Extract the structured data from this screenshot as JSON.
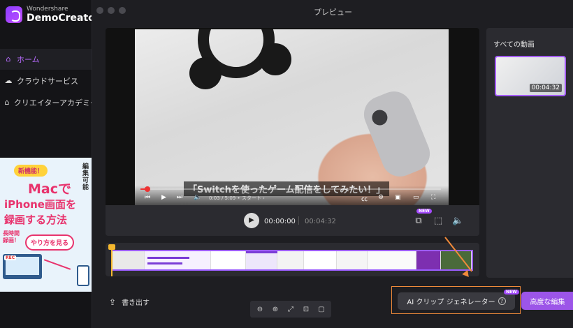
{
  "sidebar": {
    "brand": "Wondershare",
    "product": "DemoCreator",
    "items": [
      {
        "label": "ホーム",
        "icon": "home-icon"
      },
      {
        "label": "クラウドサービス",
        "icon": "cloud-icon"
      },
      {
        "label": "クリエイターアカデミー",
        "icon": "graduation-cap-icon"
      }
    ],
    "promo": {
      "badge": "新機能！",
      "side_text": "編集可能",
      "line1": "Macで",
      "line2": "iPhone画面を",
      "line3": "録画する方法",
      "time_text": "長時間録画！",
      "howto": "やり方を見る",
      "rec": "REC"
    }
  },
  "modal": {
    "title": "プレビュー",
    "video": {
      "subtitle": "「Switchを使ったゲーム配信をしてみたい！」",
      "yt_time": "0:03 / 5:09 • スタート ›"
    },
    "player": {
      "current_time": "00:00:00",
      "total_time": "00:04:32",
      "new_badge": "NEW"
    },
    "gallery": {
      "title": "すべての動画",
      "thumb_duration": "00:04:32"
    },
    "footer": {
      "export_label": "書き出す",
      "ai_label": "AI クリップ ジェネレーター",
      "ai_help": "?",
      "ai_new": "NEW",
      "advanced_label": "高度な編集"
    }
  },
  "colors": {
    "accent": "#9c55e8",
    "highlight": "#f08a3a",
    "playhead": "#f5b82e"
  }
}
